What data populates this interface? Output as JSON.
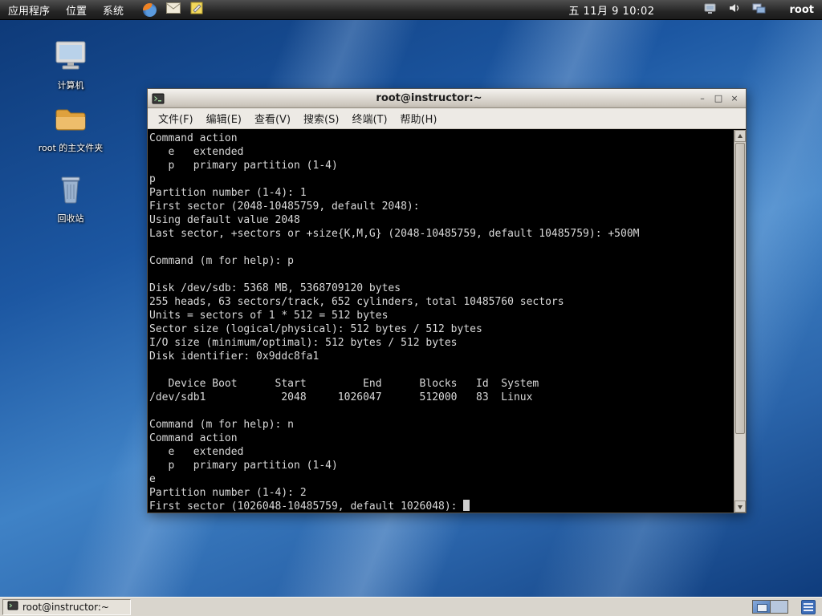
{
  "top_panel": {
    "menus": [
      "应用程序",
      "位置",
      "系统"
    ],
    "clock": "五 11月 9 10:02",
    "user": "root"
  },
  "desktop_icons": [
    "计算机",
    "root 的主文件夹",
    "回收站"
  ],
  "window": {
    "title": "root@instructor:~",
    "controls": {
      "minimize": "–",
      "maximize": "□",
      "close": "×"
    },
    "menu_items": [
      "文件(F)",
      "编辑(E)",
      "查看(V)",
      "搜索(S)",
      "终端(T)",
      "帮助(H)"
    ],
    "lines": [
      "Command action",
      "   e   extended",
      "   p   primary partition (1-4)",
      "p",
      "Partition number (1-4): 1",
      "First sector (2048-10485759, default 2048):",
      "Using default value 2048",
      "Last sector, +sectors or +size{K,M,G} (2048-10485759, default 10485759): +500M",
      "",
      "Command (m for help): p",
      "",
      "Disk /dev/sdb: 5368 MB, 5368709120 bytes",
      "255 heads, 63 sectors/track, 652 cylinders, total 10485760 sectors",
      "Units = sectors of 1 * 512 = 512 bytes",
      "Sector size (logical/physical): 512 bytes / 512 bytes",
      "I/O size (minimum/optimal): 512 bytes / 512 bytes",
      "Disk identifier: 0x9ddc8fa1",
      "",
      "   Device Boot      Start         End      Blocks   Id  System",
      "/dev/sdb1            2048     1026047      512000   83  Linux",
      "",
      "Command (m for help): n",
      "Command action",
      "   e   extended",
      "   p   primary partition (1-4)",
      "e",
      "Partition number (1-4): 2",
      "First sector (1026048-10485759, default 1026048): "
    ]
  },
  "taskbar": {
    "task": "root@instructor:~"
  }
}
